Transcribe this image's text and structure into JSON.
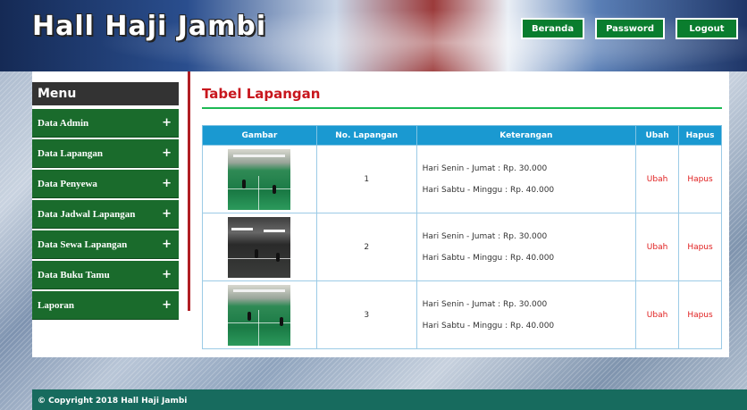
{
  "header": {
    "title": "Hall Haji Jambi",
    "nav": [
      "Beranda",
      "Password",
      "Logout"
    ]
  },
  "sidebar": {
    "heading": "Menu",
    "items": [
      {
        "label": "Data Admin",
        "expand": "+"
      },
      {
        "label": "Data Lapangan",
        "expand": "+"
      },
      {
        "label": "Data Penyewa",
        "expand": "+"
      },
      {
        "label": "Data Jadwal Lapangan",
        "expand": "+"
      },
      {
        "label": "Data Sewa Lapangan",
        "expand": "+"
      },
      {
        "label": "Data Buku Tamu",
        "expand": "+"
      },
      {
        "label": "Laporan",
        "expand": "+"
      }
    ]
  },
  "main": {
    "title": "Tabel Lapangan",
    "columns": [
      "Gambar",
      "No. Lapangan",
      "Keterangan",
      "Ubah",
      "Hapus"
    ],
    "rows": [
      {
        "image": "court-photo-green",
        "no": "1",
        "ket1": "Hari Senin - Jumat : Rp. 30.000",
        "ket2": "Hari Sabtu - Minggu : Rp. 40.000",
        "edit": "Ubah",
        "delete": "Hapus"
      },
      {
        "image": "court-photo-dark",
        "no": "2",
        "ket1": "Hari Senin - Jumat : Rp. 30.000",
        "ket2": "Hari Sabtu - Minggu : Rp. 40.000",
        "edit": "Ubah",
        "delete": "Hapus"
      },
      {
        "image": "court-photo-green",
        "no": "3",
        "ket1": "Hari Senin - Jumat : Rp. 30.000",
        "ket2": "Hari Sabtu - Minggu : Rp. 40.000",
        "edit": "Ubah",
        "delete": "Hapus"
      }
    ]
  },
  "footer": {
    "text": "© Copyright 2018 Hall Haji Jambi"
  },
  "colors": {
    "menu_green": "#1a6b2c",
    "table_header": "#1a99d1",
    "title_red": "#c8161d",
    "footer_teal": "#176b5e"
  }
}
